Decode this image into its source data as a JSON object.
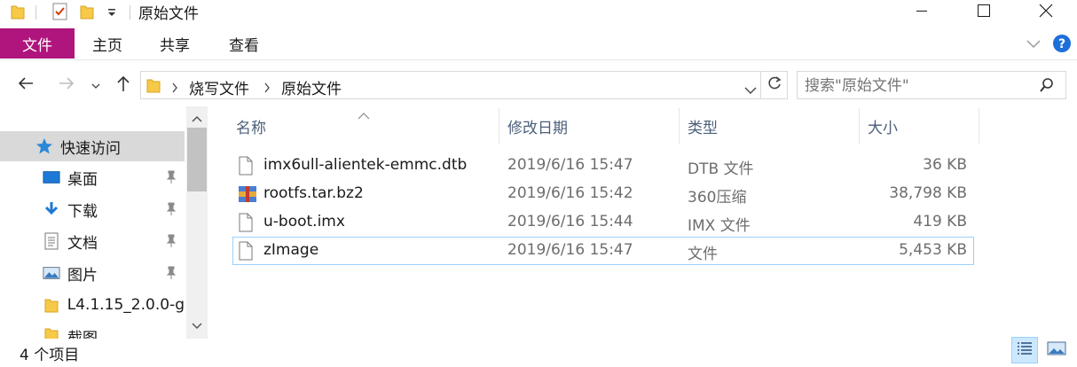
{
  "window": {
    "title": "原始文件",
    "minimize_icon": "minimize-icon",
    "maximize_icon": "maximize-icon",
    "close_icon": "close-icon"
  },
  "ribbon": {
    "tabs": [
      "文件",
      "主页",
      "共享",
      "查看"
    ]
  },
  "address": {
    "segments": [
      "烧写文件",
      "原始文件"
    ]
  },
  "search": {
    "placeholder": "搜索\"原始文件\""
  },
  "navpane": {
    "quick_access": "快速访问",
    "items": [
      "桌面",
      "下载",
      "文档",
      "图片",
      "L4.1.15_2.0.0-g",
      "截图"
    ]
  },
  "columns": {
    "name": "名称",
    "date": "修改日期",
    "type": "类型",
    "size": "大小"
  },
  "files": [
    {
      "name": "imx6ull-alientek-emmc.dtb",
      "date": "2019/6/16 15:47",
      "type": "DTB 文件",
      "size": "36 KB",
      "icon": "file-icon"
    },
    {
      "name": "rootfs.tar.bz2",
      "date": "2019/6/16 15:42",
      "type": "360压缩",
      "size": "38,798 KB",
      "icon": "archive-icon"
    },
    {
      "name": "u-boot.imx",
      "date": "2019/6/16 15:44",
      "type": "IMX 文件",
      "size": "419 KB",
      "icon": "file-icon"
    },
    {
      "name": "zImage",
      "date": "2019/6/16 15:47",
      "type": "文件",
      "size": "5,453 KB",
      "icon": "file-icon"
    }
  ],
  "status": {
    "item_count": "4 个项目"
  },
  "colors": {
    "file_tab": "#b0147d",
    "header_text": "#4c607a",
    "focus_border": "#99d1ff"
  }
}
